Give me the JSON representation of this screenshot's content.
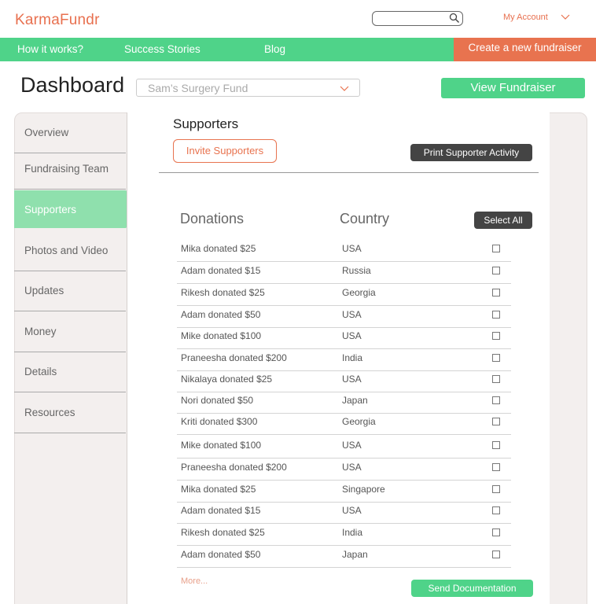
{
  "brand": {
    "logo": "KarmaFundr",
    "accent": "#e8734f",
    "green": "#4fd389"
  },
  "header": {
    "search_placeholder": "",
    "account_label": "My Account"
  },
  "nav": {
    "items": [
      "How it works?",
      "Success Stories",
      "Blog"
    ],
    "create_label": "Create a new fundraiser"
  },
  "dashboard": {
    "title": "Dashboard",
    "selected_fund": "Sam’s Surgery Fund",
    "view_label": "View  Fundraiser"
  },
  "sidebar": {
    "items": [
      {
        "label": "Overview",
        "active": false
      },
      {
        "label": "Fundraising Team",
        "active": false
      },
      {
        "label": "Supporters",
        "active": true
      },
      {
        "label": "Photos and Video",
        "active": false
      },
      {
        "label": "Updates",
        "active": false
      },
      {
        "label": "Money",
        "active": false
      },
      {
        "label": "Details",
        "active": false
      },
      {
        "label": "Resources",
        "active": false
      }
    ]
  },
  "supporters": {
    "title": "Supporters",
    "invite_label": "Invite Supporters",
    "print_label": "Print Supporter Activity",
    "col_donations": "Donations",
    "col_country": "Country",
    "select_all_label": "Select All",
    "rows": [
      {
        "donation": "Mika donated $25",
        "country": "USA",
        "checked": false
      },
      {
        "donation": "Adam donated $15",
        "country": "Russia",
        "checked": false
      },
      {
        "donation": "Rikesh donated $25",
        "country": "Georgia",
        "checked": false
      },
      {
        "donation": "Adam donated $50",
        "country": "USA",
        "checked": false
      },
      {
        "donation": "Mike donated $100",
        "country": "USA",
        "checked": false
      },
      {
        "donation": "Praneesha donated $200",
        "country": "India",
        "checked": false
      },
      {
        "donation": "Nikalaya donated $25",
        "country": "USA",
        "checked": false
      },
      {
        "donation": "Nori donated $50",
        "country": "Japan",
        "checked": false
      },
      {
        "donation": "Kriti donated $300",
        "country": "Georgia",
        "checked": false
      },
      {
        "donation": "Mike donated $100",
        "country": "USA",
        "checked": false
      },
      {
        "donation": "Praneesha donated $200",
        "country": "USA",
        "checked": false
      },
      {
        "donation": "Mika donated $25",
        "country": "Singapore",
        "checked": false
      },
      {
        "donation": "Adam donated $15",
        "country": "USA",
        "checked": false
      },
      {
        "donation": "Rikesh donated $25",
        "country": "India",
        "checked": false
      },
      {
        "donation": "Adam donated $50",
        "country": "Japan",
        "checked": false
      }
    ],
    "more_label": "More...",
    "send_label": "Send Documentation"
  }
}
